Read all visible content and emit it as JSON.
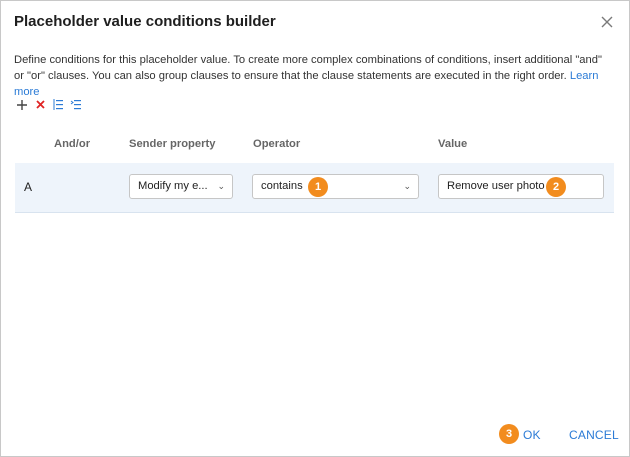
{
  "dialog": {
    "title": "Placeholder value conditions builder",
    "description": "Define conditions for this placeholder value. To create more complex combinations of conditions, insert additional \"and\" or \"or\" clauses. You can also group clauses to ensure that the clause statements are executed in the right order.",
    "learn_more": "Learn more"
  },
  "toolbar": {
    "icons": [
      "plus-icon",
      "delete-icon",
      "group-icon",
      "ungroup-icon"
    ]
  },
  "table": {
    "headers": {
      "andor": "And/or",
      "sender_property": "Sender property",
      "operator": "Operator",
      "value": "Value"
    },
    "rows": [
      {
        "label": "A",
        "andor": "",
        "sender_property": "Modify my e...",
        "operator": "contains",
        "value": "Remove user photo"
      }
    ]
  },
  "badges": {
    "b1": "1",
    "b2": "2",
    "b3": "3"
  },
  "buttons": {
    "ok": "OK",
    "cancel": "CANCEL"
  },
  "colors": {
    "accent": "#2b7bd6",
    "badge": "#f28c1e",
    "row_bg": "#eef4fb"
  }
}
